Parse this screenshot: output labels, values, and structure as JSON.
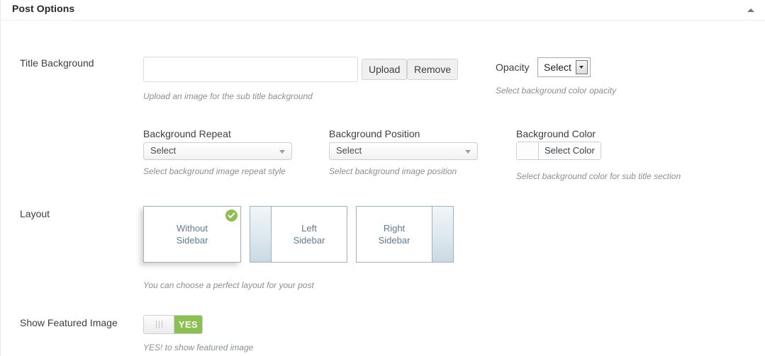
{
  "header": {
    "title": "Post Options",
    "collapse_icon": "caret-up-icon"
  },
  "rows": {
    "title_background": {
      "label": "Title Background",
      "input_value": "",
      "input_placeholder": "",
      "upload_label": "Upload",
      "remove_label": "Remove",
      "help": "Upload an image for the sub title background"
    },
    "opacity": {
      "label": "Opacity",
      "selected": "Select",
      "help": "Select background color opacity"
    },
    "background_repeat": {
      "label": "Background Repeat",
      "selected": "Select",
      "help": "Select background image repeat style"
    },
    "background_position": {
      "label": "Background Position",
      "selected": "Select",
      "help": "Select background image position"
    },
    "background_color": {
      "label": "Background Color",
      "button_label": "Select Color",
      "swatch_color": "#fdfdfd",
      "help": "Select background color for sub title section"
    },
    "layout": {
      "label": "Layout",
      "help": "You can choose a perfect layout for your post",
      "selected_index": 0,
      "check_color": "#8cc152",
      "options": [
        {
          "name": "without-sidebar",
          "line1": "Without",
          "line2": "Sidebar",
          "sidebar": "none",
          "selected": true
        },
        {
          "name": "left-sidebar",
          "line1": "Left",
          "line2": "Sidebar",
          "sidebar": "left",
          "selected": false
        },
        {
          "name": "right-sidebar",
          "line1": "Right",
          "line2": "Sidebar",
          "sidebar": "right",
          "selected": false
        }
      ]
    },
    "show_featured_image": {
      "label": "Show Featured Image",
      "state_label": "YES",
      "state_on": true,
      "on_color": "#8cc152",
      "help": "YES! to show featured image"
    }
  }
}
